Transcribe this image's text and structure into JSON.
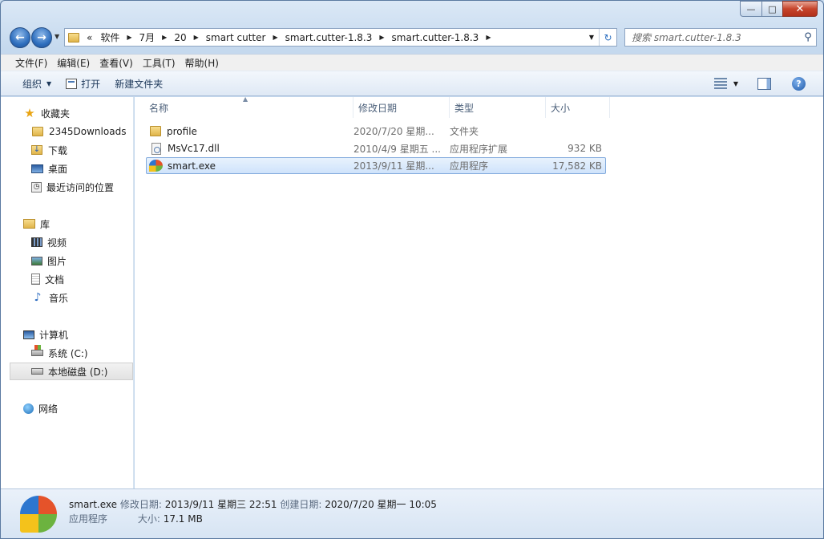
{
  "window": {
    "caption_buttons": {
      "minimize": "—",
      "maximize": "□",
      "close": "✕"
    }
  },
  "address": {
    "overflow": "«",
    "breadcrumbs": [
      "软件",
      "7月",
      "20",
      "smart cutter",
      "smart.cutter-1.8.3",
      "smart.cutter-1.8.3"
    ]
  },
  "search": {
    "placeholder": "搜索 smart.cutter-1.8.3"
  },
  "menubar": [
    "文件(F)",
    "编辑(E)",
    "查看(V)",
    "工具(T)",
    "帮助(H)"
  ],
  "toolbar": {
    "organize": "组织",
    "open": "打开",
    "new_folder": "新建文件夹",
    "help": "?"
  },
  "navpane": {
    "favorites": {
      "label": "收藏夹",
      "items": [
        "2345Downloads",
        "下载",
        "桌面",
        "最近访问的位置"
      ]
    },
    "libraries": {
      "label": "库",
      "items": [
        "视频",
        "图片",
        "文档",
        "音乐"
      ]
    },
    "computer": {
      "label": "计算机",
      "items": [
        "系统 (C:)",
        "本地磁盘 (D:)"
      ]
    },
    "network": {
      "label": "网络"
    }
  },
  "columns": {
    "name": "名称",
    "date": "修改日期",
    "type": "类型",
    "size": "大小"
  },
  "files": [
    {
      "name": "profile",
      "date": "2020/7/20 星期...",
      "type": "文件夹",
      "size": "",
      "icon": "folder-icon"
    },
    {
      "name": "MsVc17.dll",
      "date": "2010/4/9 星期五 ...",
      "type": "应用程序扩展",
      "size": "932 KB",
      "icon": "dll-file-icon"
    },
    {
      "name": "smart.exe",
      "date": "2013/9/11 星期...",
      "type": "应用程序",
      "size": "17,582 KB",
      "icon": "exe-app-icon"
    }
  ],
  "details": {
    "name": "smart.exe",
    "modified_label": "修改日期:",
    "modified_value": "2013/9/11 星期三 22:51",
    "created_label": "创建日期:",
    "created_value": "2020/7/20 星期一 10:05",
    "type": "应用程序",
    "size_label": "大小:",
    "size_value": "17.1 MB"
  }
}
